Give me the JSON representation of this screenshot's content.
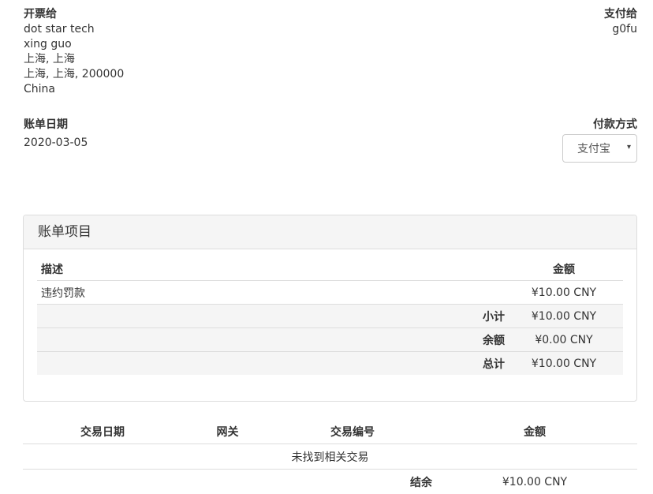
{
  "bill_to": {
    "heading": "开票给",
    "company": "dot star tech",
    "name": "xing guo",
    "city_state": "上海, 上海",
    "city_state_zip": "上海, 上海, 200000",
    "country": "China"
  },
  "pay_to": {
    "heading": "支付给",
    "name": "g0fu"
  },
  "invoice_date": {
    "label": "账单日期",
    "value": "2020-03-05"
  },
  "payment_method": {
    "label": "付款方式",
    "selected": "支付宝",
    "caret": "▾"
  },
  "items_panel": {
    "title": "账单项目",
    "col_description": "描述",
    "col_amount": "金额",
    "rows": [
      {
        "description": "违约罚款",
        "amount": "¥10.00 CNY"
      }
    ],
    "subtotal_label": "小计",
    "subtotal_value": "¥10.00 CNY",
    "credit_label": "余额",
    "credit_value": "¥0.00 CNY",
    "total_label": "总计",
    "total_value": "¥10.00 CNY"
  },
  "transactions": {
    "col_date": "交易日期",
    "col_gateway": "网关",
    "col_txn_id": "交易编号",
    "col_amount": "金额",
    "empty_message": "未找到相关交易",
    "balance_label": "结余",
    "balance_value": "¥10.00 CNY"
  }
}
